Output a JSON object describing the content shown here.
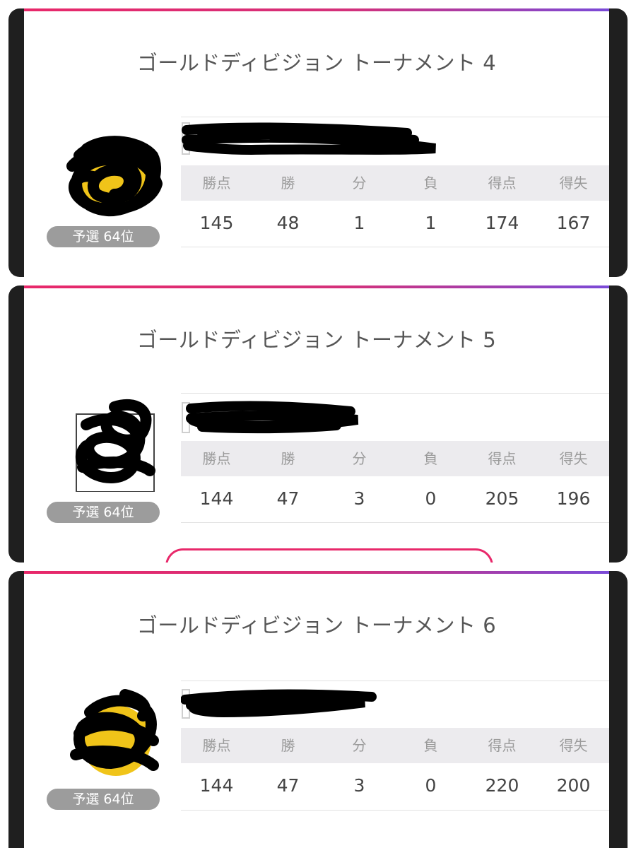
{
  "panels": [
    {
      "title": "ゴールドディビジョン トーナメント 4",
      "rank": "予選 64位",
      "headers": [
        "勝点",
        "勝",
        "分",
        "負",
        "得点",
        "得失"
      ],
      "values": [
        "145",
        "48",
        "1",
        "1",
        "174",
        "167"
      ]
    },
    {
      "title": "ゴールドディビジョン トーナメント 5",
      "rank": "予選 64位",
      "headers": [
        "勝点",
        "勝",
        "分",
        "負",
        "得点",
        "得失"
      ],
      "values": [
        "144",
        "47",
        "3",
        "0",
        "205",
        "196"
      ]
    },
    {
      "title": "ゴールドディビジョン トーナメント 6",
      "rank": "予選 64位",
      "headers": [
        "勝点",
        "勝",
        "分",
        "負",
        "得点",
        "得失"
      ],
      "values": [
        "144",
        "47",
        "3",
        "0",
        "220",
        "200"
      ]
    }
  ],
  "colors": {
    "accent_gradient_start": "#e8286a",
    "accent_gradient_end": "#7a4ad8",
    "rank_badge": "#9c9c9c",
    "stats_header_bg": "#ecebee",
    "redaction": "#000000"
  },
  "icons": {
    "avatar": "team-emblem-icon (redacted)",
    "name": "player-name (redacted)"
  }
}
